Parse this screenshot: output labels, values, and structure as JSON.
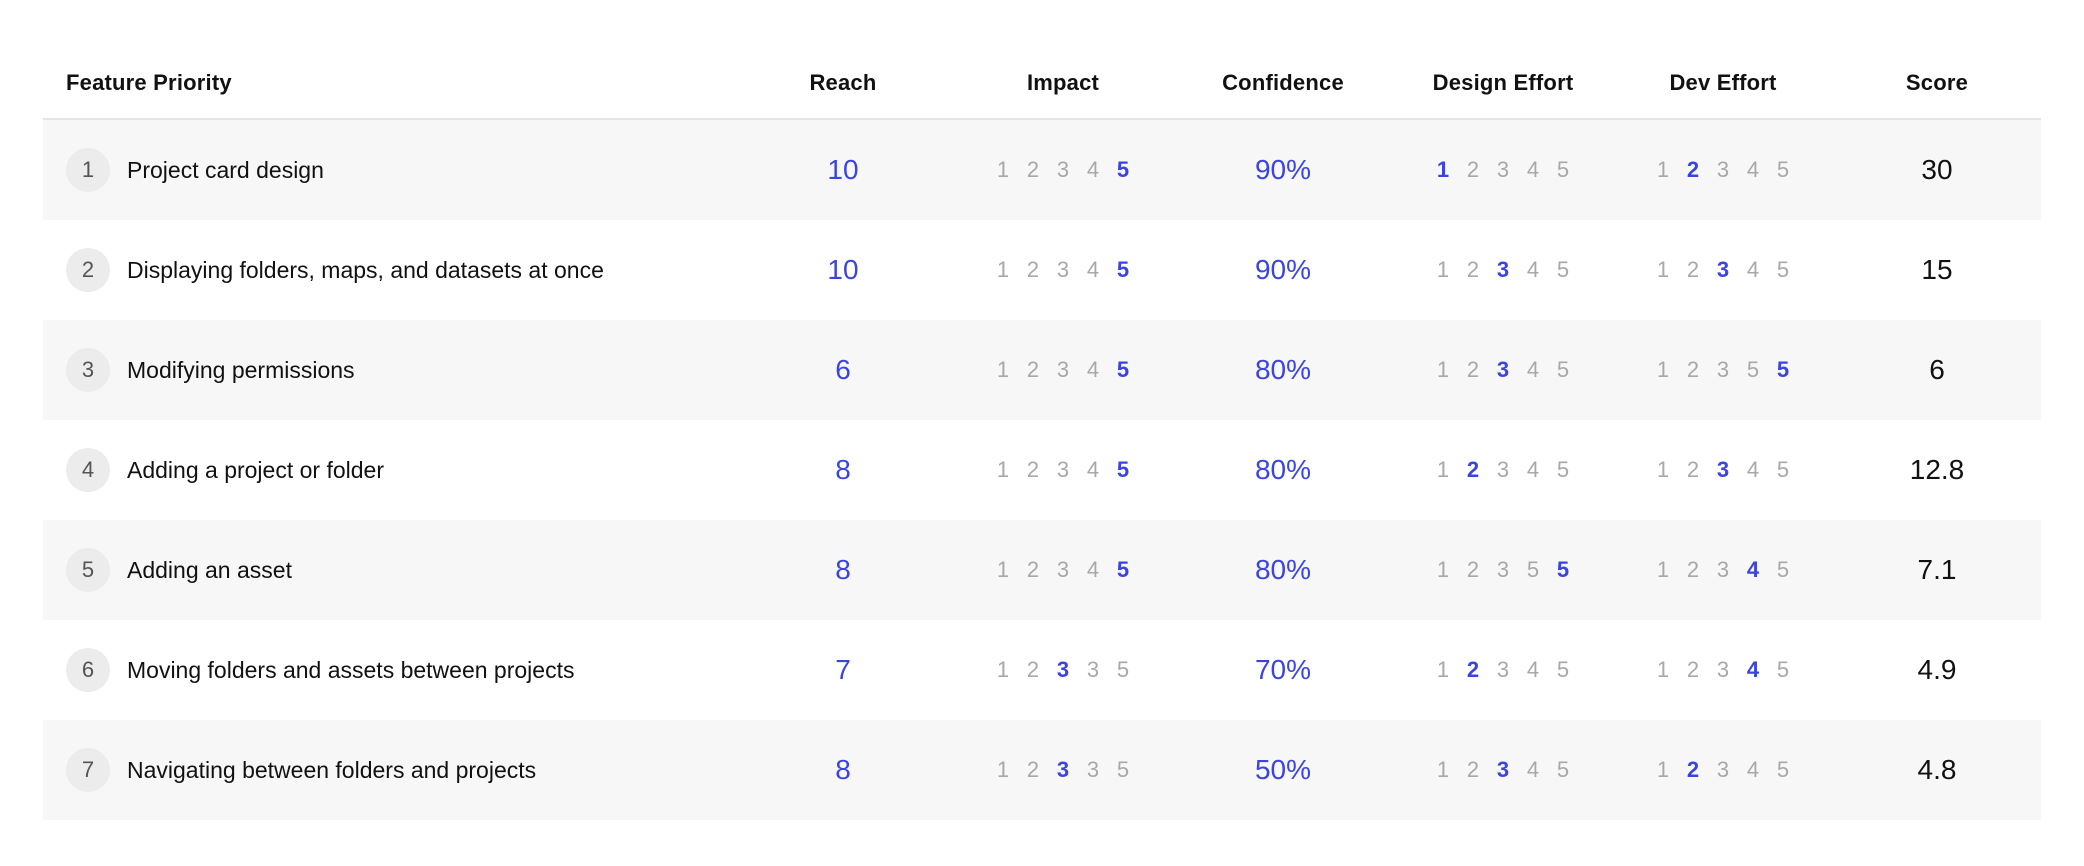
{
  "headers": {
    "feature": "Feature Priority",
    "reach": "Reach",
    "impact": "Impact",
    "confidence": "Confidence",
    "design_effort": "Design Effort",
    "dev_effort": "Dev Effort",
    "score": "Score"
  },
  "colors": {
    "accent": "#3b44e0",
    "muted": "#a8a8a8",
    "stripe": "#f7f7f7"
  },
  "rows": [
    {
      "num": "1",
      "name": "Project card design",
      "reach": "10",
      "impact": {
        "labels": [
          "1",
          "2",
          "3",
          "4",
          "5"
        ],
        "selected": 4
      },
      "confidence": "90%",
      "design": {
        "labels": [
          "1",
          "2",
          "3",
          "4",
          "5"
        ],
        "selected": 0
      },
      "dev": {
        "labels": [
          "1",
          "2",
          "3",
          "4",
          "5"
        ],
        "selected": 1
      },
      "score": "30"
    },
    {
      "num": "2",
      "name": "Displaying folders, maps, and datasets at once",
      "reach": "10",
      "impact": {
        "labels": [
          "1",
          "2",
          "3",
          "4",
          "5"
        ],
        "selected": 4
      },
      "confidence": "90%",
      "design": {
        "labels": [
          "1",
          "2",
          "3",
          "4",
          "5"
        ],
        "selected": 2
      },
      "dev": {
        "labels": [
          "1",
          "2",
          "3",
          "4",
          "5"
        ],
        "selected": 2
      },
      "score": "15"
    },
    {
      "num": "3",
      "name": "Modifying permissions",
      "reach": "6",
      "impact": {
        "labels": [
          "1",
          "2",
          "3",
          "4",
          "5"
        ],
        "selected": 4
      },
      "confidence": "80%",
      "design": {
        "labels": [
          "1",
          "2",
          "3",
          "4",
          "5"
        ],
        "selected": 2
      },
      "dev": {
        "labels": [
          "1",
          "2",
          "3",
          "5",
          "5"
        ],
        "selected": 4
      },
      "score": "6"
    },
    {
      "num": "4",
      "name": "Adding a project or folder",
      "reach": "8",
      "impact": {
        "labels": [
          "1",
          "2",
          "3",
          "4",
          "5"
        ],
        "selected": 4
      },
      "confidence": "80%",
      "design": {
        "labels": [
          "1",
          "2",
          "3",
          "4",
          "5"
        ],
        "selected": 1
      },
      "dev": {
        "labels": [
          "1",
          "2",
          "3",
          "4",
          "5"
        ],
        "selected": 2
      },
      "score": "12.8"
    },
    {
      "num": "5",
      "name": "Adding an asset",
      "reach": "8",
      "impact": {
        "labels": [
          "1",
          "2",
          "3",
          "4",
          "5"
        ],
        "selected": 4
      },
      "confidence": "80%",
      "design": {
        "labels": [
          "1",
          "2",
          "3",
          "5",
          "5"
        ],
        "selected": 4
      },
      "dev": {
        "labels": [
          "1",
          "2",
          "3",
          "4",
          "5"
        ],
        "selected": 3
      },
      "score": "7.1"
    },
    {
      "num": "6",
      "name": "Moving folders and assets between projects",
      "reach": "7",
      "impact": {
        "labels": [
          "1",
          "2",
          "3",
          "3",
          "5"
        ],
        "selected": 2
      },
      "confidence": "70%",
      "design": {
        "labels": [
          "1",
          "2",
          "3",
          "4",
          "5"
        ],
        "selected": 1
      },
      "dev": {
        "labels": [
          "1",
          "2",
          "3",
          "4",
          "5"
        ],
        "selected": 3
      },
      "score": "4.9"
    },
    {
      "num": "7",
      "name": "Navigating between folders and projects",
      "reach": "8",
      "impact": {
        "labels": [
          "1",
          "2",
          "3",
          "3",
          "5"
        ],
        "selected": 2
      },
      "confidence": "50%",
      "design": {
        "labels": [
          "1",
          "2",
          "3",
          "4",
          "5"
        ],
        "selected": 2
      },
      "dev": {
        "labels": [
          "1",
          "2",
          "3",
          "4",
          "5"
        ],
        "selected": 1
      },
      "score": "4.8"
    }
  ]
}
